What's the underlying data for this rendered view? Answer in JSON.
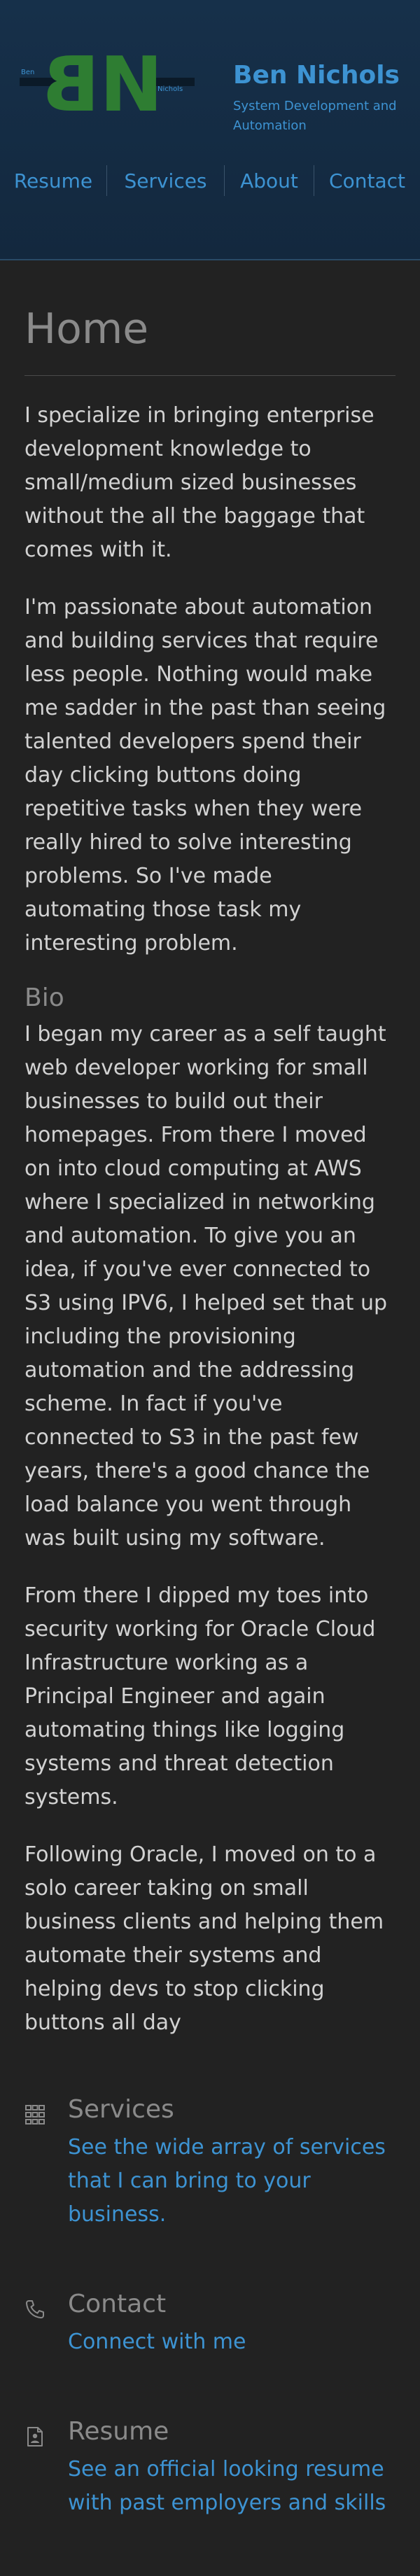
{
  "header": {
    "logo": {
      "monogram_first": "B",
      "monogram_last": "N",
      "small_first": "Ben",
      "small_last": "Nichols"
    },
    "site_name": "Ben Nichols",
    "tagline": "System Development and Automation",
    "nav": [
      {
        "label": "Resume"
      },
      {
        "label": "Services"
      },
      {
        "label": "About"
      },
      {
        "label": "Contact"
      }
    ]
  },
  "main": {
    "page_title": "Home",
    "intro": [
      "I specialize in bringing enterprise development knowledge to small/medium sized businesses without the all the baggage that comes with it.",
      "I'm passionate about automation and building services that require less people. Nothing would make me sadder in the past than seeing talented developers spend their day clicking buttons doing repetitive tasks when they were really hired to solve interesting problems. So I've made automating those task my interesting problem."
    ],
    "bio_heading": "Bio",
    "bio": [
      "I began my career as a self taught web developer working for small businesses to build out their homepages. From there I moved on into cloud computing at AWS where I specialized in networking and automation. To give you an idea, if you've ever connected to S3 using IPV6, I helped set that up including the provisioning automation and the addressing scheme. In fact if you've connected to S3 in the past few years, there's a good chance the load balance you went through was built using my software.",
      "From there I dipped my toes into security working for Oracle Cloud Infrastructure working as a Principal Engineer and again automating things like logging systems and threat detection systems.",
      "Following Oracle, I moved on to a solo career taking on small business clients and helping them automate their systems and helping devs to stop clicking buttons all day"
    ],
    "cards": [
      {
        "icon": "grid-icon",
        "title": "Services",
        "link_text": "See the wide array of services that I can bring to your business."
      },
      {
        "icon": "phone-icon",
        "title": "Contact",
        "link_text": "Connect with me"
      },
      {
        "icon": "document-person-icon",
        "title": "Resume",
        "link_text": "See an official looking resume with past employers and skills"
      }
    ]
  },
  "colors": {
    "background": "#222222",
    "header_background": "#142a40",
    "accent": "#3d93d2",
    "logo_green": "#2e7d32",
    "muted_heading": "#8a8a8a",
    "body_text": "#d2d2d2"
  }
}
